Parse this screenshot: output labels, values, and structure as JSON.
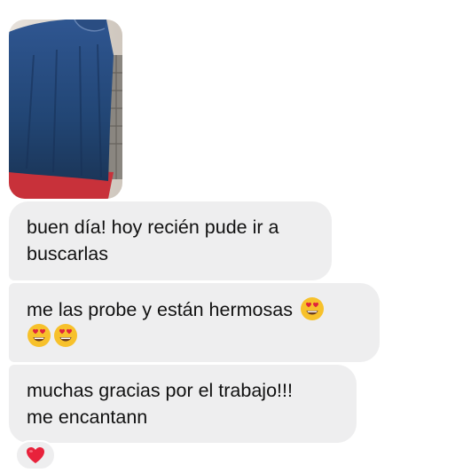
{
  "messages": [
    {
      "line1": "buen día! hoy recién pude ir a",
      "line2": "buscarlas"
    },
    {
      "line1": "me las probe y están hermosas",
      "emojis": [
        "heart-eyes",
        "heart-eyes",
        "heart-eyes"
      ]
    },
    {
      "line1": "muchas gracias por el trabajo!!!",
      "line2": "me encantann"
    }
  ],
  "reaction": {
    "icon": "red-heart",
    "color": "#e8223b"
  },
  "colors": {
    "bubble": "#eeeeef",
    "text": "#111111",
    "background": "#ffffff"
  }
}
